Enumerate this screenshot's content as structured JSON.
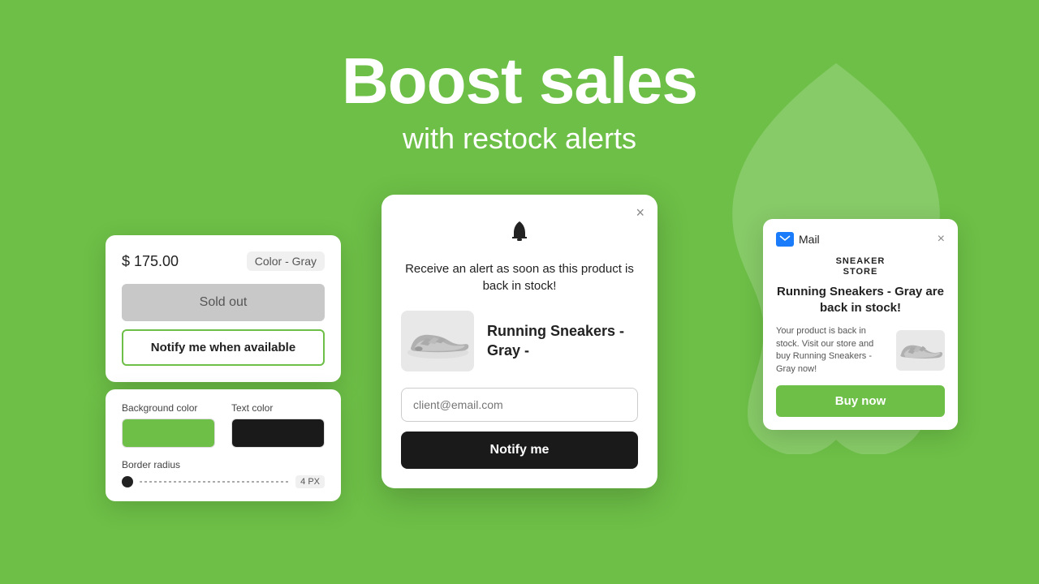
{
  "header": {
    "title": "Boost sales",
    "subtitle": "with restock alerts"
  },
  "left_card": {
    "price": "$ 175.00",
    "color": "Color - Gray",
    "sold_out_label": "Sold out",
    "notify_label": "Notify me when available"
  },
  "custom_panel": {
    "bg_color_label": "Background color",
    "text_color_label": "Text color",
    "border_radius_label": "Border radius",
    "border_radius_value": "4 PX"
  },
  "center_modal": {
    "close_label": "×",
    "bell_icon": "🔔",
    "title": "Receive an alert as soon as this product is back in stock!",
    "product_name": "Running Sneakers - Gray -",
    "email_placeholder": "client@email.com",
    "notify_btn_label": "Notify me"
  },
  "right_card": {
    "close_label": "×",
    "mail_label": "Mail",
    "store_line1": "SNEAKER",
    "store_line2": "STORE",
    "headline": "Running Sneakers - Gray are back in stock!",
    "body_text": "Your product is back in stock. Visit our store and buy Running Sneakers - Gray now!",
    "buy_btn_label": "Buy now"
  }
}
